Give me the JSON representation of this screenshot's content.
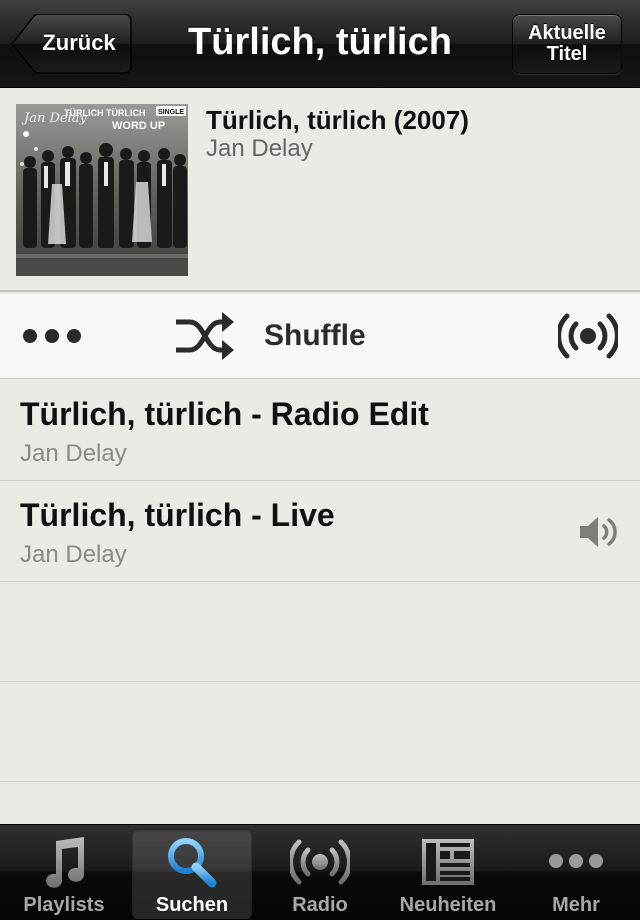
{
  "nav": {
    "title": "Türlich, türlich",
    "back_label": "Zurück",
    "now_playing_line1": "Aktuelle",
    "now_playing_line2": "Titel"
  },
  "album": {
    "title": "Türlich, türlich (2007)",
    "artist": "Jan Delay",
    "cover_text_artist": "Jan Delay",
    "cover_text_title": "TÜRLICH TÜRLICH",
    "cover_text_sub": "WORD UP",
    "cover_text_badge": "SINGLE"
  },
  "shuffle": {
    "label": "Shuffle",
    "more_icon": "more-dots-icon",
    "shuffle_icon": "shuffle-icon",
    "radio_icon": "radio-broadcast-icon"
  },
  "tracks": [
    {
      "title": "Türlich, türlich - Radio Edit",
      "artist": "Jan Delay",
      "playing": false
    },
    {
      "title": "Türlich, türlich - Live",
      "artist": "Jan Delay",
      "playing": true
    }
  ],
  "tabs": [
    {
      "label": "Playlists",
      "icon": "music-note-icon",
      "active": false
    },
    {
      "label": "Suchen",
      "icon": "search-icon",
      "active": true
    },
    {
      "label": "Radio",
      "icon": "radio-icon",
      "active": false
    },
    {
      "label": "Neuheiten",
      "icon": "news-icon",
      "active": false
    },
    {
      "label": "Mehr",
      "icon": "more-icon",
      "active": false
    }
  ],
  "colors": {
    "accent_blue": "#3ba3e6",
    "background": "#ebebe6",
    "secondary_text": "#8a8a86"
  }
}
